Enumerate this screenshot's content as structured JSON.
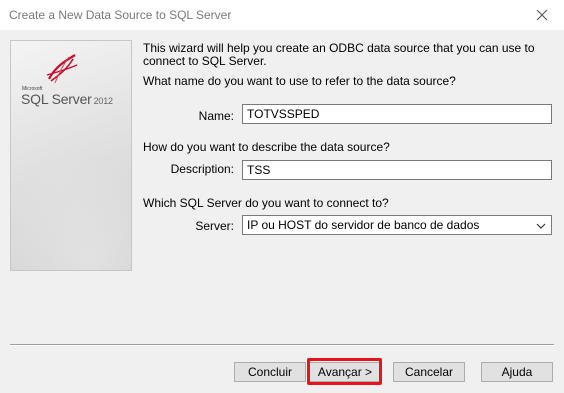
{
  "window": {
    "title": "Create a New Data Source to SQL Server",
    "close_icon": "close-icon"
  },
  "logo": {
    "microsoft": "Microsoft",
    "product": "SQL Server",
    "year": "2012"
  },
  "form": {
    "intro": "This wizard will help you create an ODBC data source that you can use to connect to SQL Server.",
    "name_question": "What name do you want to use to refer to the data source?",
    "name_label": "Name:",
    "name_value": "TOTVSSPED",
    "description_question": "How do you want to describe the data source?",
    "description_label": "Description:",
    "description_value": "TSS",
    "server_question": "Which SQL Server do you want to connect to?",
    "server_label": "Server:",
    "server_value": "IP ou HOST do servidor de banco de dados"
  },
  "buttons": {
    "finish": "Concluir",
    "next": "Avançar >",
    "cancel": "Cancelar",
    "help": "Ajuda"
  },
  "colors": {
    "highlight": "#e8141c",
    "logo_red": "#c8102e"
  }
}
